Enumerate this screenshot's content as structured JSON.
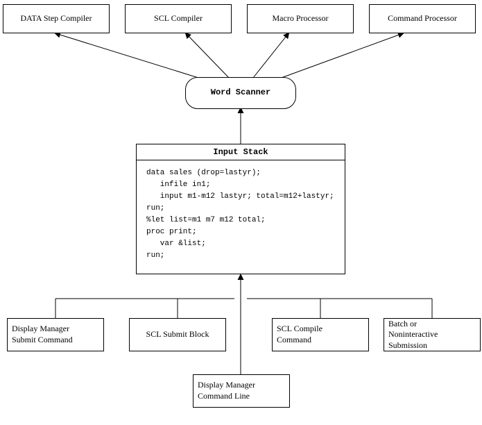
{
  "top": {
    "data_step": "DATA Step Compiler",
    "scl_compiler": "SCL Compiler",
    "macro_processor": "Macro Processor",
    "command_processor": "Command Processor"
  },
  "scanner": {
    "label": "Word Scanner"
  },
  "stack": {
    "title": "Input Stack",
    "code": "data sales (drop=lastyr);\n   infile in1;\n   input m1-m12 lastyr; total=m12+lastyr;\nrun;\n%let list=m1 m7 m12 total;\nproc print;\n   var &list;\nrun;"
  },
  "bottom": {
    "display_submit": "Display Manager\nSubmit Command",
    "scl_submit": "SCL Submit Block",
    "scl_compile": "SCL Compile\nCommand",
    "batch": "Batch or\nNoninteractive\nSubmission",
    "cmd_line": "Display Manager\nCommand Line"
  }
}
